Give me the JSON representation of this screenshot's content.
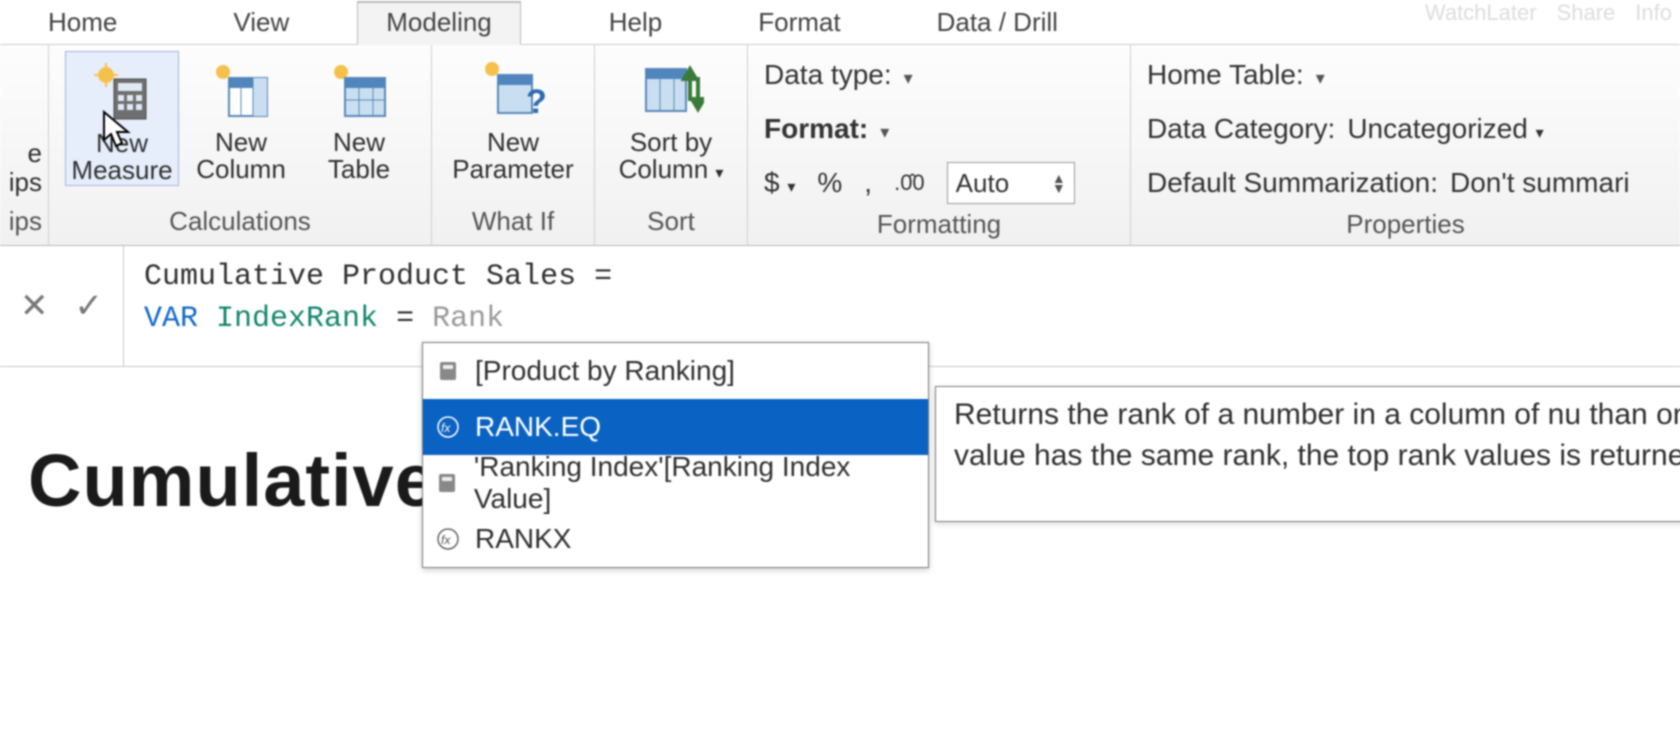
{
  "top_right": {
    "a": "WatchLater",
    "b": "Share",
    "c": "Info"
  },
  "tabs": {
    "home": "Home",
    "view": "View",
    "modeling": "Modeling",
    "help": "Help",
    "format": "Format",
    "datadrill": "Data / Drill"
  },
  "left_col": {
    "l1": "e",
    "l2": "ips",
    "l3": "ips"
  },
  "groups": {
    "calculations": {
      "label": "Calculations",
      "new_measure": {
        "l1": "New",
        "l2": "Measure"
      },
      "new_column": {
        "l1": "New",
        "l2": "Column"
      },
      "new_table": {
        "l1": "New",
        "l2": "Table"
      }
    },
    "whatif": {
      "label": "What If",
      "new_parameter": {
        "l1": "New",
        "l2": "Parameter"
      }
    },
    "sort": {
      "label": "Sort",
      "sort_by_column": {
        "l1": "Sort by",
        "l2": "Column"
      }
    },
    "formatting": {
      "label": "Formatting",
      "data_type": "Data type:",
      "format": "Format:",
      "currency": "$",
      "percent": "%",
      "thousand": ",",
      "decimals_icon": ".00",
      "decimals_value": "Auto"
    },
    "properties": {
      "label": "Properties",
      "home_table": "Home Table:",
      "data_category_label": "Data Category:",
      "data_category_value": "Uncategorized",
      "summ_label": "Default Summarization:",
      "summ_value": "Don't summari"
    }
  },
  "formula": {
    "cancel": "✕",
    "accept": "✓",
    "line1": "Cumulative Product Sales =",
    "var": "VAR",
    "name": "IndexRank",
    "eq": "=",
    "typed": "Rank"
  },
  "intellisense": {
    "items": [
      {
        "icon": "calc",
        "label": "[Product by Ranking]"
      },
      {
        "icon": "fx",
        "label": "RANK.EQ"
      },
      {
        "icon": "calc",
        "label": "'Ranking Index'[Ranking Index Value]"
      },
      {
        "icon": "fx",
        "label": "RANKX"
      }
    ]
  },
  "tooltip": "Returns the rank of a number in a column of nu than one value has the same rank, the top rank values is returned.",
  "canvas_title": "Cumulative"
}
